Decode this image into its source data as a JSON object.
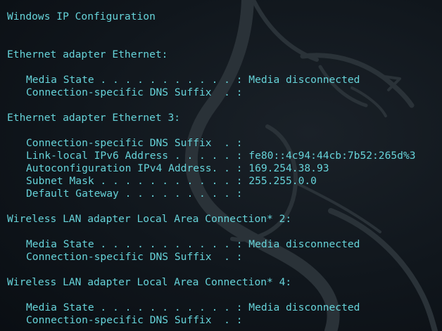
{
  "colors": {
    "background": "#0c1117",
    "text": "#66d3d9",
    "watermark": "#2a3238"
  },
  "title": "Windows IP Configuration",
  "adapters": [
    {
      "header": "Ethernet adapter Ethernet:",
      "lines": [
        "Media State . . . . . . . . . . . : Media disconnected",
        "Connection-specific DNS Suffix  . :"
      ]
    },
    {
      "header": "Ethernet adapter Ethernet 3:",
      "lines": [
        "Connection-specific DNS Suffix  . :",
        "Link-local IPv6 Address . . . . . : fe80::4c94:44cb:7b52:265d%3",
        "Autoconfiguration IPv4 Address. . : 169.254.38.93",
        "Subnet Mask . . . . . . . . . . . : 255.255.0.0",
        "Default Gateway . . . . . . . . . :"
      ]
    },
    {
      "header": "Wireless LAN adapter Local Area Connection* 2:",
      "lines": [
        "Media State . . . . . . . . . . . : Media disconnected",
        "Connection-specific DNS Suffix  . :"
      ]
    },
    {
      "header": "Wireless LAN adapter Local Area Connection* 4:",
      "lines": [
        "Media State . . . . . . . . . . . : Media disconnected",
        "Connection-specific DNS Suffix  . :"
      ]
    }
  ]
}
